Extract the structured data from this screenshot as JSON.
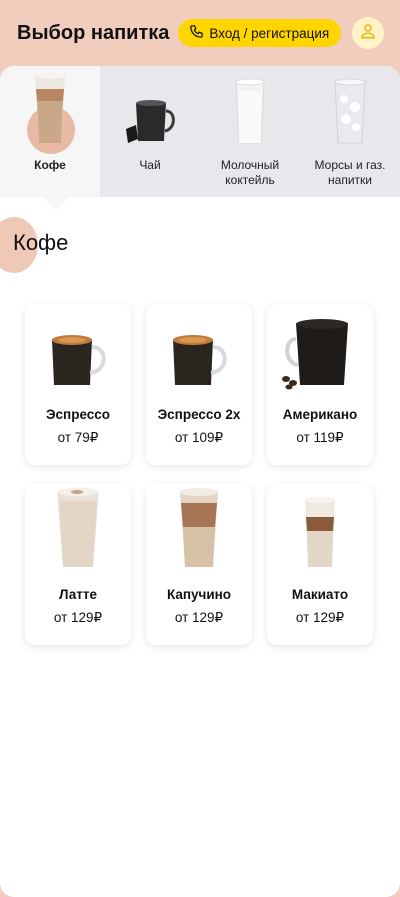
{
  "header": {
    "title": "Выбор напитка",
    "login_label": "Вход / регистрация"
  },
  "tabs": [
    {
      "label": "Кофе",
      "active": true,
      "icon": "latte-glass-icon"
    },
    {
      "label": "Чай",
      "active": false,
      "icon": "tea-cup-icon"
    },
    {
      "label": "Молочный коктейль",
      "active": false,
      "icon": "milkshake-glass-icon"
    },
    {
      "label": "Морсы и газ. напитки",
      "active": false,
      "icon": "soda-glass-icon"
    }
  ],
  "section": {
    "title": "Кофе"
  },
  "products": [
    {
      "name": "Эспрессо",
      "price": "от 79₽",
      "icon": "espresso-cup-icon"
    },
    {
      "name": "Эспрессо 2х",
      "price": "от 109₽",
      "icon": "double-espresso-cup-icon"
    },
    {
      "name": "Американо",
      "price": "от 119₽",
      "icon": "americano-cup-icon"
    },
    {
      "name": "Латте",
      "price": "от 129₽",
      "icon": "latte-glass-icon"
    },
    {
      "name": "Капучино",
      "price": "от 129₽",
      "icon": "cappuccino-glass-icon"
    },
    {
      "name": "Макиато",
      "price": "от 129₽",
      "icon": "macchiato-glass-icon"
    }
  ],
  "colors": {
    "header_bg": "#f1cdbd",
    "accent_yellow": "#ffd500",
    "tabs_bg": "#e7e7ec",
    "highlight_dot": "#e8b9a5"
  }
}
